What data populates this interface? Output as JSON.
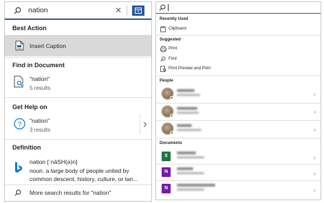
{
  "left_panel": {
    "search": {
      "query": "nation",
      "clear_glyph": "✕",
      "search_icon": "search-icon"
    },
    "best_action": {
      "heading": "Best Action",
      "item_label": "Insert Caption",
      "item_icon": "insert-caption-icon"
    },
    "find_in_document": {
      "heading": "Find in Document",
      "query": "\"nation\"",
      "count": "5 results"
    },
    "get_help": {
      "heading": "Get Help on",
      "query": "\"nation\"",
      "count": "3 results"
    },
    "definition": {
      "heading": "Definition",
      "word_line": "nation [ˈnāSH(ə)n]",
      "meaning_line1": "noun. a large body of people united by",
      "meaning_line2": "common descent, history, culture, or lan..."
    },
    "more_results": "More search results for \"nation\""
  },
  "right_panel": {
    "recently_used": {
      "heading": "Recently Used",
      "items": [
        "Clipboard"
      ]
    },
    "suggested": {
      "heading": "Suggested",
      "items": [
        "Print",
        "Find",
        "Print Preview and Print"
      ]
    },
    "people": {
      "heading": "People"
    },
    "documents": {
      "heading": "Documents"
    }
  },
  "colors": {
    "accent": "#2b579a",
    "highlight": "#d9d9d9",
    "help_blue": "#0078d4",
    "bing_blue": "#0078d4",
    "excel_green": "#217346",
    "onenote_purple": "#7719aa"
  }
}
